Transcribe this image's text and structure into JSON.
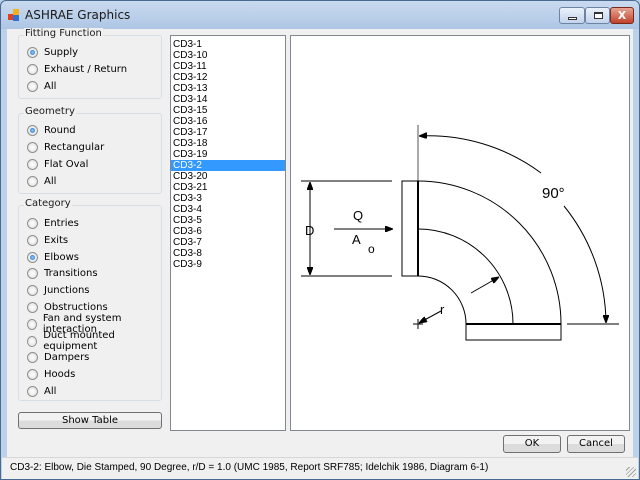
{
  "window": {
    "title": "ASHRAE Graphics",
    "minimize": "minimize",
    "maximize": "maximize",
    "close": "X"
  },
  "fitting_function": {
    "label": "Fitting Function",
    "options": [
      "Supply",
      "Exhaust / Return",
      "All"
    ],
    "selected": "Supply"
  },
  "geometry": {
    "label": "Geometry",
    "options": [
      "Round",
      "Rectangular",
      "Flat Oval",
      "All"
    ],
    "selected": "Round"
  },
  "category": {
    "label": "Category",
    "options": [
      "Entries",
      "Exits",
      "Elbows",
      "Transitions",
      "Junctions",
      "Obstructions",
      "Fan and system interaction",
      "Duct mounted equipment",
      "Dampers",
      "Hoods",
      "All"
    ],
    "selected": "Elbows"
  },
  "show_table": "Show Table",
  "fittings": {
    "items": [
      "CD3-1",
      "CD3-10",
      "CD3-11",
      "CD3-12",
      "CD3-13",
      "CD3-14",
      "CD3-15",
      "CD3-16",
      "CD3-17",
      "CD3-18",
      "CD3-19",
      "CD3-2",
      "CD3-20",
      "CD3-21",
      "CD3-3",
      "CD3-4",
      "CD3-5",
      "CD3-6",
      "CD3-7",
      "CD3-8",
      "CD3-9"
    ],
    "selected": "CD3-2"
  },
  "drawing": {
    "angle": "90°",
    "dim_d": "D",
    "flow_q": "Q",
    "area_a": "A",
    "area_sub": "o",
    "radius": "r"
  },
  "buttons": {
    "ok": "OK",
    "cancel": "Cancel"
  },
  "status": "CD3-2: Elbow, Die Stamped, 90 Degree, r/D = 1.0 (UMC 1985, Report SRF785; Idelchik 1986, Diagram 6-1)",
  "colors": {
    "selection": "#3399ff",
    "close": "#c0412a"
  }
}
